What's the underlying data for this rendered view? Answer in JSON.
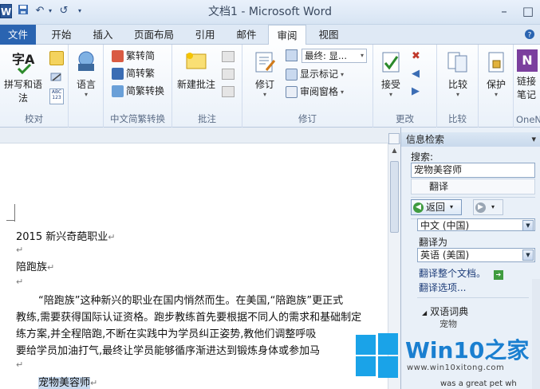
{
  "app": {
    "icon_letter": "W",
    "window_title": "文档1 - Microsoft Word"
  },
  "quick_access": {
    "undo_arrow": "↶",
    "redo_arrow": "↺",
    "customize": "▾"
  },
  "window_controls": {
    "minimize": "–",
    "restore": "□"
  },
  "tabs": {
    "file": "文件",
    "items": [
      "开始",
      "插入",
      "页面布局",
      "引用",
      "邮件",
      "审阅",
      "视图"
    ],
    "active": "审阅"
  },
  "ribbon": {
    "proofing": {
      "group": "校对",
      "spelling": "拼写和语法"
    },
    "language": {
      "label": "语言"
    },
    "chinese_conversion": {
      "group": "中文简繁转换",
      "to_simplified": "繁转简",
      "to_traditional": "简转繁",
      "conversion": "简繁转换"
    },
    "comments": {
      "group": "批注",
      "new_comment": "新建批注"
    },
    "tracking": {
      "group": "修订",
      "track_changes": "修订",
      "final_display": "最终: 显...",
      "show_markup": "显示标记",
      "reviewing_pane": "审阅窗格"
    },
    "changes": {
      "group": "更改",
      "accept": "接受"
    },
    "compare": {
      "group": "比较",
      "compare": "比较"
    },
    "protect": {
      "label": "保护"
    },
    "onenote": {
      "group": "OneN",
      "linked_notes_1": "链接",
      "linked_notes_2": "笔记"
    }
  },
  "document": {
    "lines": [
      "2015 新兴奇葩职业",
      "陪跑族",
      "“陪跑族”这种新兴的职业在国内悄然而生。在美国,“陪跑族”更正式",
      "教练,需要获得国际认证资格。跑步教练首先要根据不同人的需求和基础制定",
      "练方案,并全程陪跑,不断在实践中为学员纠正姿势,教他们调整呼吸",
      "要给学员加油打气,最终让学员能够循序渐进达到锻炼身体或参加马",
      "宠物美容师"
    ],
    "para_mark": "↵"
  },
  "research_pane": {
    "title": "信息检索",
    "search_label": "搜索:",
    "search_value": "宠物美容师",
    "service": "翻译",
    "back": "返回",
    "from_language": "中文 (中国)",
    "translate_to_label": "翻译为",
    "to_language": "英语 (美国)",
    "translate_doc": "翻译整个文档。",
    "options": "翻译选项...",
    "bilingual": "双语词典",
    "sub_item": "宠物",
    "example": "was a great pet wh"
  },
  "watermark": {
    "brand": "Win10",
    "brand_zh": "之家",
    "url": "www.win10xitong.com"
  }
}
